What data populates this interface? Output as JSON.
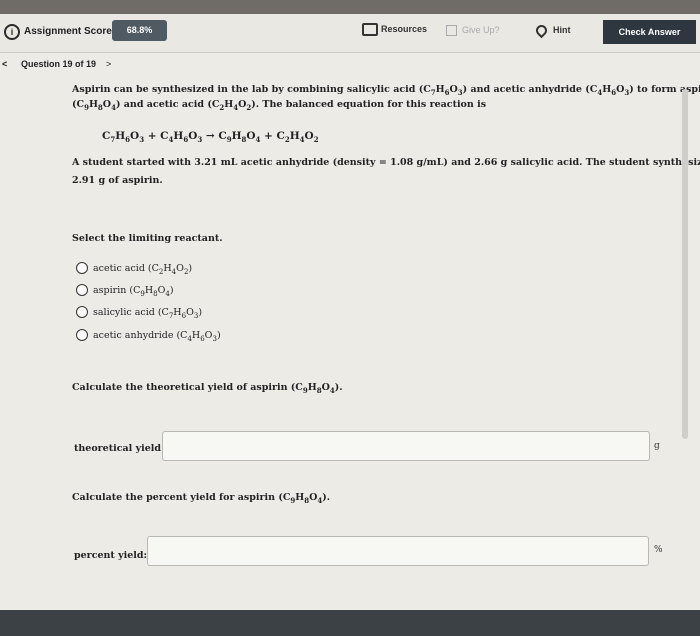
{
  "header": {
    "assignment_score_label": "Assignment Score:",
    "assignment_score_value": "68.8%",
    "resources_label": "Resources",
    "give_up_label": "Give Up?",
    "hint_label": "Hint",
    "check_answer_label": "Check Answer"
  },
  "nav": {
    "question_label": "Question 19 of 19",
    "prev_symbol": "<",
    "next_symbol": ">"
  },
  "problem": {
    "intro_line1": "Aspirin can be synthesized in the lab by combining salicylic acid (C7H6O3) and acetic anhydride (C4H6O3) to form aspirin",
    "intro_line2": "(C9H8O4) and acetic acid (C2H4O2). The balanced equation for this reaction is",
    "equation": "C7H6O3 + C4H6O3 → C9H8O4 + C2H4O2",
    "data_line1": "A student started with 3.21 mL acetic anhydride (density = 1.08 g/mL) and 2.66 g salicylic acid. The student synthesized",
    "data_line2": "2.91 g of aspirin."
  },
  "limiting": {
    "prompt": "Select the limiting reactant.",
    "options": [
      "acetic acid (C2H4O2)",
      "aspirin (C9H8O4)",
      "salicylic acid (C7H6O3)",
      "acetic anhydride (C4H6O3)"
    ]
  },
  "theoretical": {
    "prompt": "Calculate the theoretical yield of aspirin (C9H8O4).",
    "label": "theoretical yield:",
    "value": "",
    "unit": "g"
  },
  "percent": {
    "prompt": "Calculate the percent yield for aspirin (C9H8O4).",
    "label": "percent yield:",
    "value": "",
    "unit": "%"
  }
}
